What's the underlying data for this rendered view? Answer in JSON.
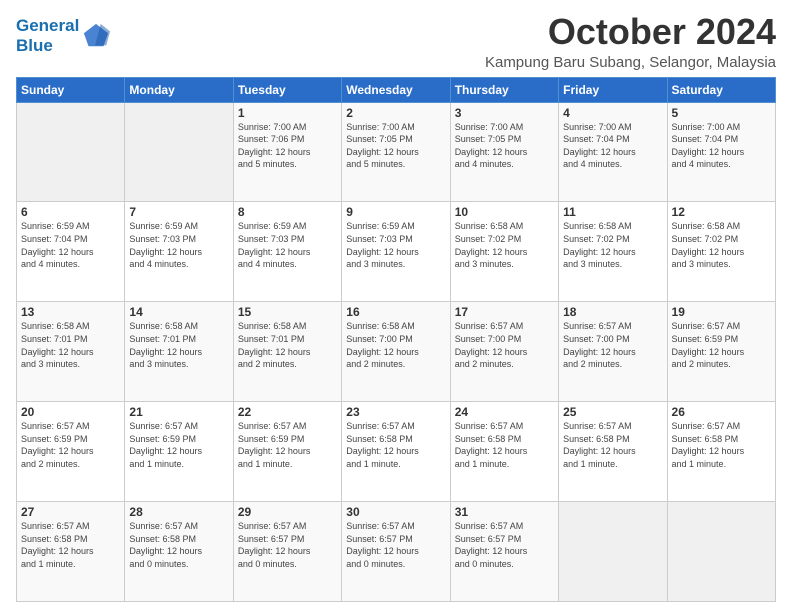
{
  "logo": {
    "line1": "General",
    "line2": "Blue"
  },
  "title": "October 2024",
  "location": "Kampung Baru Subang, Selangor, Malaysia",
  "days_of_week": [
    "Sunday",
    "Monday",
    "Tuesday",
    "Wednesday",
    "Thursday",
    "Friday",
    "Saturday"
  ],
  "weeks": [
    [
      {
        "day": "",
        "detail": ""
      },
      {
        "day": "",
        "detail": ""
      },
      {
        "day": "1",
        "detail": "Sunrise: 7:00 AM\nSunset: 7:06 PM\nDaylight: 12 hours\nand 5 minutes."
      },
      {
        "day": "2",
        "detail": "Sunrise: 7:00 AM\nSunset: 7:05 PM\nDaylight: 12 hours\nand 5 minutes."
      },
      {
        "day": "3",
        "detail": "Sunrise: 7:00 AM\nSunset: 7:05 PM\nDaylight: 12 hours\nand 4 minutes."
      },
      {
        "day": "4",
        "detail": "Sunrise: 7:00 AM\nSunset: 7:04 PM\nDaylight: 12 hours\nand 4 minutes."
      },
      {
        "day": "5",
        "detail": "Sunrise: 7:00 AM\nSunset: 7:04 PM\nDaylight: 12 hours\nand 4 minutes."
      }
    ],
    [
      {
        "day": "6",
        "detail": "Sunrise: 6:59 AM\nSunset: 7:04 PM\nDaylight: 12 hours\nand 4 minutes."
      },
      {
        "day": "7",
        "detail": "Sunrise: 6:59 AM\nSunset: 7:03 PM\nDaylight: 12 hours\nand 4 minutes."
      },
      {
        "day": "8",
        "detail": "Sunrise: 6:59 AM\nSunset: 7:03 PM\nDaylight: 12 hours\nand 4 minutes."
      },
      {
        "day": "9",
        "detail": "Sunrise: 6:59 AM\nSunset: 7:03 PM\nDaylight: 12 hours\nand 3 minutes."
      },
      {
        "day": "10",
        "detail": "Sunrise: 6:58 AM\nSunset: 7:02 PM\nDaylight: 12 hours\nand 3 minutes."
      },
      {
        "day": "11",
        "detail": "Sunrise: 6:58 AM\nSunset: 7:02 PM\nDaylight: 12 hours\nand 3 minutes."
      },
      {
        "day": "12",
        "detail": "Sunrise: 6:58 AM\nSunset: 7:02 PM\nDaylight: 12 hours\nand 3 minutes."
      }
    ],
    [
      {
        "day": "13",
        "detail": "Sunrise: 6:58 AM\nSunset: 7:01 PM\nDaylight: 12 hours\nand 3 minutes."
      },
      {
        "day": "14",
        "detail": "Sunrise: 6:58 AM\nSunset: 7:01 PM\nDaylight: 12 hours\nand 3 minutes."
      },
      {
        "day": "15",
        "detail": "Sunrise: 6:58 AM\nSunset: 7:01 PM\nDaylight: 12 hours\nand 2 minutes."
      },
      {
        "day": "16",
        "detail": "Sunrise: 6:58 AM\nSunset: 7:00 PM\nDaylight: 12 hours\nand 2 minutes."
      },
      {
        "day": "17",
        "detail": "Sunrise: 6:57 AM\nSunset: 7:00 PM\nDaylight: 12 hours\nand 2 minutes."
      },
      {
        "day": "18",
        "detail": "Sunrise: 6:57 AM\nSunset: 7:00 PM\nDaylight: 12 hours\nand 2 minutes."
      },
      {
        "day": "19",
        "detail": "Sunrise: 6:57 AM\nSunset: 6:59 PM\nDaylight: 12 hours\nand 2 minutes."
      }
    ],
    [
      {
        "day": "20",
        "detail": "Sunrise: 6:57 AM\nSunset: 6:59 PM\nDaylight: 12 hours\nand 2 minutes."
      },
      {
        "day": "21",
        "detail": "Sunrise: 6:57 AM\nSunset: 6:59 PM\nDaylight: 12 hours\nand 1 minute."
      },
      {
        "day": "22",
        "detail": "Sunrise: 6:57 AM\nSunset: 6:59 PM\nDaylight: 12 hours\nand 1 minute."
      },
      {
        "day": "23",
        "detail": "Sunrise: 6:57 AM\nSunset: 6:58 PM\nDaylight: 12 hours\nand 1 minute."
      },
      {
        "day": "24",
        "detail": "Sunrise: 6:57 AM\nSunset: 6:58 PM\nDaylight: 12 hours\nand 1 minute."
      },
      {
        "day": "25",
        "detail": "Sunrise: 6:57 AM\nSunset: 6:58 PM\nDaylight: 12 hours\nand 1 minute."
      },
      {
        "day": "26",
        "detail": "Sunrise: 6:57 AM\nSunset: 6:58 PM\nDaylight: 12 hours\nand 1 minute."
      }
    ],
    [
      {
        "day": "27",
        "detail": "Sunrise: 6:57 AM\nSunset: 6:58 PM\nDaylight: 12 hours\nand 1 minute."
      },
      {
        "day": "28",
        "detail": "Sunrise: 6:57 AM\nSunset: 6:58 PM\nDaylight: 12 hours\nand 0 minutes."
      },
      {
        "day": "29",
        "detail": "Sunrise: 6:57 AM\nSunset: 6:57 PM\nDaylight: 12 hours\nand 0 minutes."
      },
      {
        "day": "30",
        "detail": "Sunrise: 6:57 AM\nSunset: 6:57 PM\nDaylight: 12 hours\nand 0 minutes."
      },
      {
        "day": "31",
        "detail": "Sunrise: 6:57 AM\nSunset: 6:57 PM\nDaylight: 12 hours\nand 0 minutes."
      },
      {
        "day": "",
        "detail": ""
      },
      {
        "day": "",
        "detail": ""
      }
    ]
  ]
}
